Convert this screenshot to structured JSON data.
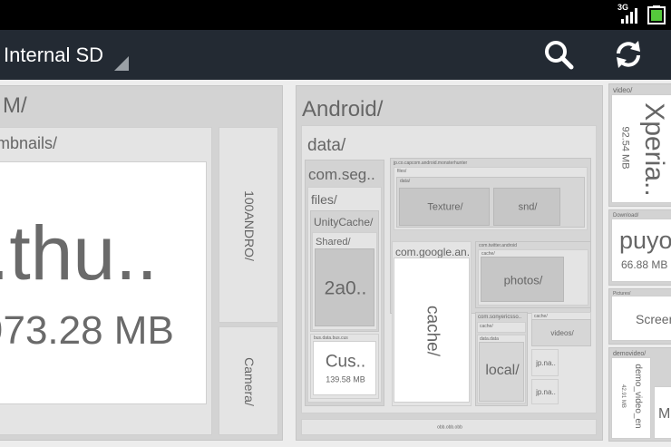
{
  "status_bar": {
    "network_label": "3G",
    "signal_icon": "signal-bars-icon",
    "battery_icon": "battery-icon",
    "battery_color": "#55c93c"
  },
  "app_bar": {
    "storage_name": "Internal SD",
    "spinner_icon": "spinner-triangle-icon",
    "search_icon": "search-icon",
    "refresh_icon": "refresh-icon"
  },
  "colors": {
    "app_bar_bg": "#232a33",
    "status_bar_bg": "#000000",
    "tile_bg": "#d3d3d3",
    "tile_light": "#ffffff",
    "label_text": "#666666"
  },
  "treemap": {
    "dcim": {
      "label": "M/",
      "thumbnails": {
        "label": "mbnails/",
        "file_name": ".thu..",
        "file_size": "973.28 MB"
      },
      "folder_100andro": "100ANDRO/",
      "folder_camera": "Camera/"
    },
    "android": {
      "label": "Android/",
      "data": {
        "label": "data/",
        "com_seg": {
          "label": "com.seg..",
          "files": "files/",
          "unity_cache": "UnityCache/",
          "shared": "Shared/",
          "file_2a0": "2a0..",
          "cus_sub": "bus.data.bus.cus",
          "cus_file": "Cus..",
          "cus_size": "139.58 MB"
        },
        "jp_capcom": {
          "label": "jp.co.capcom.android.monsterhunter",
          "files": "files/",
          "data_sub": "data/",
          "texture": "Texture/",
          "snd": "snd/"
        },
        "com_google": {
          "label": "com.google.an..",
          "cache": "cache/"
        },
        "com_twitter": {
          "label": "com.twitter.android",
          "cache_sub": "cache/",
          "photos": "photos/"
        },
        "com_sonyericsson": {
          "label": "com.sonyericsso..",
          "cache_sub": "cache/",
          "data_sub": "data.data",
          "local": "local/"
        },
        "small_folder": "cache/",
        "videos": "videos/",
        "jp_na_1": "jp.na..",
        "jp_na_2": "jp.na.."
      },
      "obb_strip": "obb.obb.obb"
    },
    "video": {
      "label": "video/",
      "xperia_name": "Xperia..",
      "xperia_size": "92.54 MB"
    },
    "download": {
      "label": "Download/",
      "puyo_name": "puyo..",
      "puyo_size": "66.88 MB"
    },
    "pictures": {
      "label": "Pictures/",
      "screen_name": "Screen"
    },
    "demovideo": {
      "label": "demovideo/",
      "demo_name": "demo_video_en",
      "demo_size": "42.91 MB",
      "m_name": "M"
    }
  }
}
